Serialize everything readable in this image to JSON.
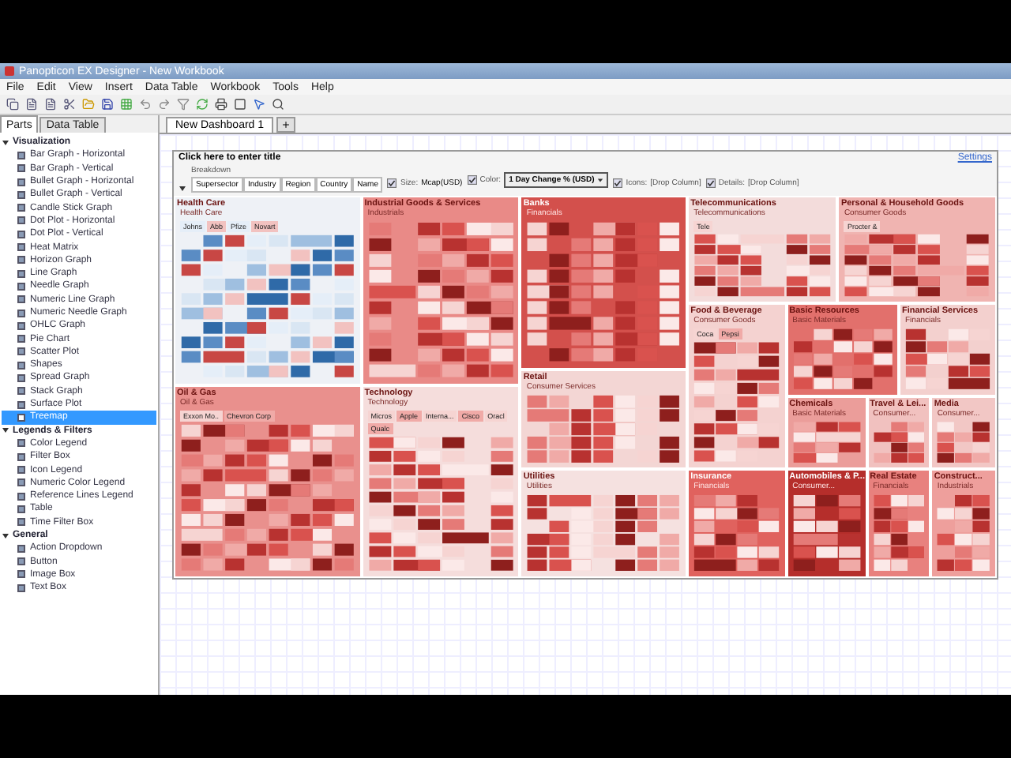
{
  "window": {
    "title": "Panopticon EX Designer - New Workbook"
  },
  "menu": [
    "File",
    "Edit",
    "View",
    "Insert",
    "Data Table",
    "Workbook",
    "Tools",
    "Help"
  ],
  "panel_tabs": [
    {
      "label": "Parts",
      "selected": true
    },
    {
      "label": "Data Table",
      "selected": false
    }
  ],
  "parts": [
    {
      "label": "Visualization",
      "expanded": true,
      "children": [
        {
          "label": "Bar Graph - Horizontal",
          "selected": false
        },
        {
          "label": "Bar Graph - Vertical",
          "selected": false
        },
        {
          "label": "Bullet Graph - Horizontal",
          "selected": false
        },
        {
          "label": "Bullet Graph - Vertical",
          "selected": false
        },
        {
          "label": "Candle Stick Graph",
          "selected": false
        },
        {
          "label": "Dot Plot - Horizontal",
          "selected": false
        },
        {
          "label": "Dot Plot - Vertical",
          "selected": false
        },
        {
          "label": "Heat Matrix",
          "selected": false
        },
        {
          "label": "Horizon Graph",
          "selected": false
        },
        {
          "label": "Line Graph",
          "selected": false
        },
        {
          "label": "Needle Graph",
          "selected": false
        },
        {
          "label": "Numeric Line Graph",
          "selected": false
        },
        {
          "label": "Numeric Needle Graph",
          "selected": false
        },
        {
          "label": "OHLC Graph",
          "selected": false
        },
        {
          "label": "Pie Chart",
          "selected": false
        },
        {
          "label": "Scatter Plot",
          "selected": false
        },
        {
          "label": "Shapes",
          "selected": false
        },
        {
          "label": "Spread Graph",
          "selected": false
        },
        {
          "label": "Stack Graph",
          "selected": false
        },
        {
          "label": "Surface Plot",
          "selected": false
        },
        {
          "label": "Treemap",
          "selected": true
        }
      ]
    },
    {
      "label": "Legends & Filters",
      "expanded": true,
      "children": [
        {
          "label": "Color Legend",
          "selected": false
        },
        {
          "label": "Filter Box",
          "selected": false
        },
        {
          "label": "Icon Legend",
          "selected": false
        },
        {
          "label": "Numeric Color Legend",
          "selected": false
        },
        {
          "label": "Reference Lines Legend",
          "selected": false
        },
        {
          "label": "Table",
          "selected": false
        },
        {
          "label": "Time Filter Box",
          "selected": false
        }
      ]
    },
    {
      "label": "General",
      "expanded": true,
      "children": [
        {
          "label": "Action Dropdown",
          "selected": false
        },
        {
          "label": "Button",
          "selected": false
        },
        {
          "label": "Image Box",
          "selected": false
        },
        {
          "label": "Text Box",
          "selected": false
        }
      ]
    }
  ],
  "dashboard_tabs": [
    {
      "label": "New Dashboard 1",
      "selected": true
    }
  ],
  "widget": {
    "title": "Click here to enter title",
    "settings": "Settings",
    "breakdown_label": "Breakdown",
    "breakdown": [
      "Supersector",
      "Industry",
      "Region",
      "Country",
      "Name"
    ],
    "size": {
      "checked": true,
      "label": "Size:",
      "value": "Mcap(USD)"
    },
    "color": {
      "checked": true,
      "label": "Color:",
      "value": "1 Day Change % (USD)"
    },
    "icons": {
      "checked": true,
      "label": "Icons:",
      "value": "[Drop Column]"
    },
    "details": {
      "checked": true,
      "label": "Details:",
      "value": "[Drop Column]"
    }
  },
  "sectors": [
    {
      "title": "Health Care",
      "group": "Health Care",
      "color": "#eef1f6",
      "labels": [
        "Johns",
        "Abb",
        "Pfize",
        "Novart"
      ]
    },
    {
      "title": "Industrial Goods & Services",
      "group": "Industrials",
      "color": "#e98a87"
    },
    {
      "title": "Banks",
      "group": "Financials",
      "color": "#d3504c"
    },
    {
      "title": "Telecommunications",
      "group": "Telecommunications",
      "color": "#f3dcdb",
      "labels": [
        "Tele"
      ]
    },
    {
      "title": "Personal & Household Goods",
      "group": "Consumer Goods",
      "color": "#f0b4b1",
      "labels": [
        "Procter &"
      ]
    },
    {
      "title": "Food & Beverage",
      "group": "Consumer Goods",
      "color": "#f4d2d0",
      "labels": [
        "Coca",
        "Pepsi"
      ]
    },
    {
      "title": "Basic Resources",
      "group": "Basic Materials",
      "color": "#e2706c"
    },
    {
      "title": "Financial Services",
      "group": "Financials",
      "color": "#f3d0ce"
    },
    {
      "title": "Retail",
      "group": "Consumer Services",
      "color": "#f3d6d4"
    },
    {
      "title": "Oil & Gas",
      "group": "Oil & Gas",
      "color": "#e9908d",
      "labels": [
        "Exxon Mo..",
        "Chevron Corp"
      ]
    },
    {
      "title": "Technology",
      "group": "Technology",
      "color": "#f5dddc",
      "labels": [
        "Micros",
        "Apple",
        "Interna...",
        "Cisco",
        "Oracl",
        "Qualc"
      ]
    },
    {
      "title": "Chemicals",
      "group": "Basic Materials",
      "color": "#eb9d9a"
    },
    {
      "title": "Travel & Lei...",
      "group": "Consumer...",
      "color": "#f1c1bf"
    },
    {
      "title": "Media",
      "group": "Consumer...",
      "color": "#f2c7c5"
    },
    {
      "title": "Utilities",
      "group": "Utilities",
      "color": "#f5e1e0"
    },
    {
      "title": "Insurance",
      "group": "Financials",
      "color": "#e0625e"
    },
    {
      "title": "Automobiles & P...",
      "group": "Consumer...",
      "color": "#b52e2b"
    },
    {
      "title": "Real Estate",
      "group": "Financials",
      "color": "#e8817e"
    },
    {
      "title": "Construct...",
      "group": "Industrials",
      "color": "#ee9f9c"
    }
  ]
}
